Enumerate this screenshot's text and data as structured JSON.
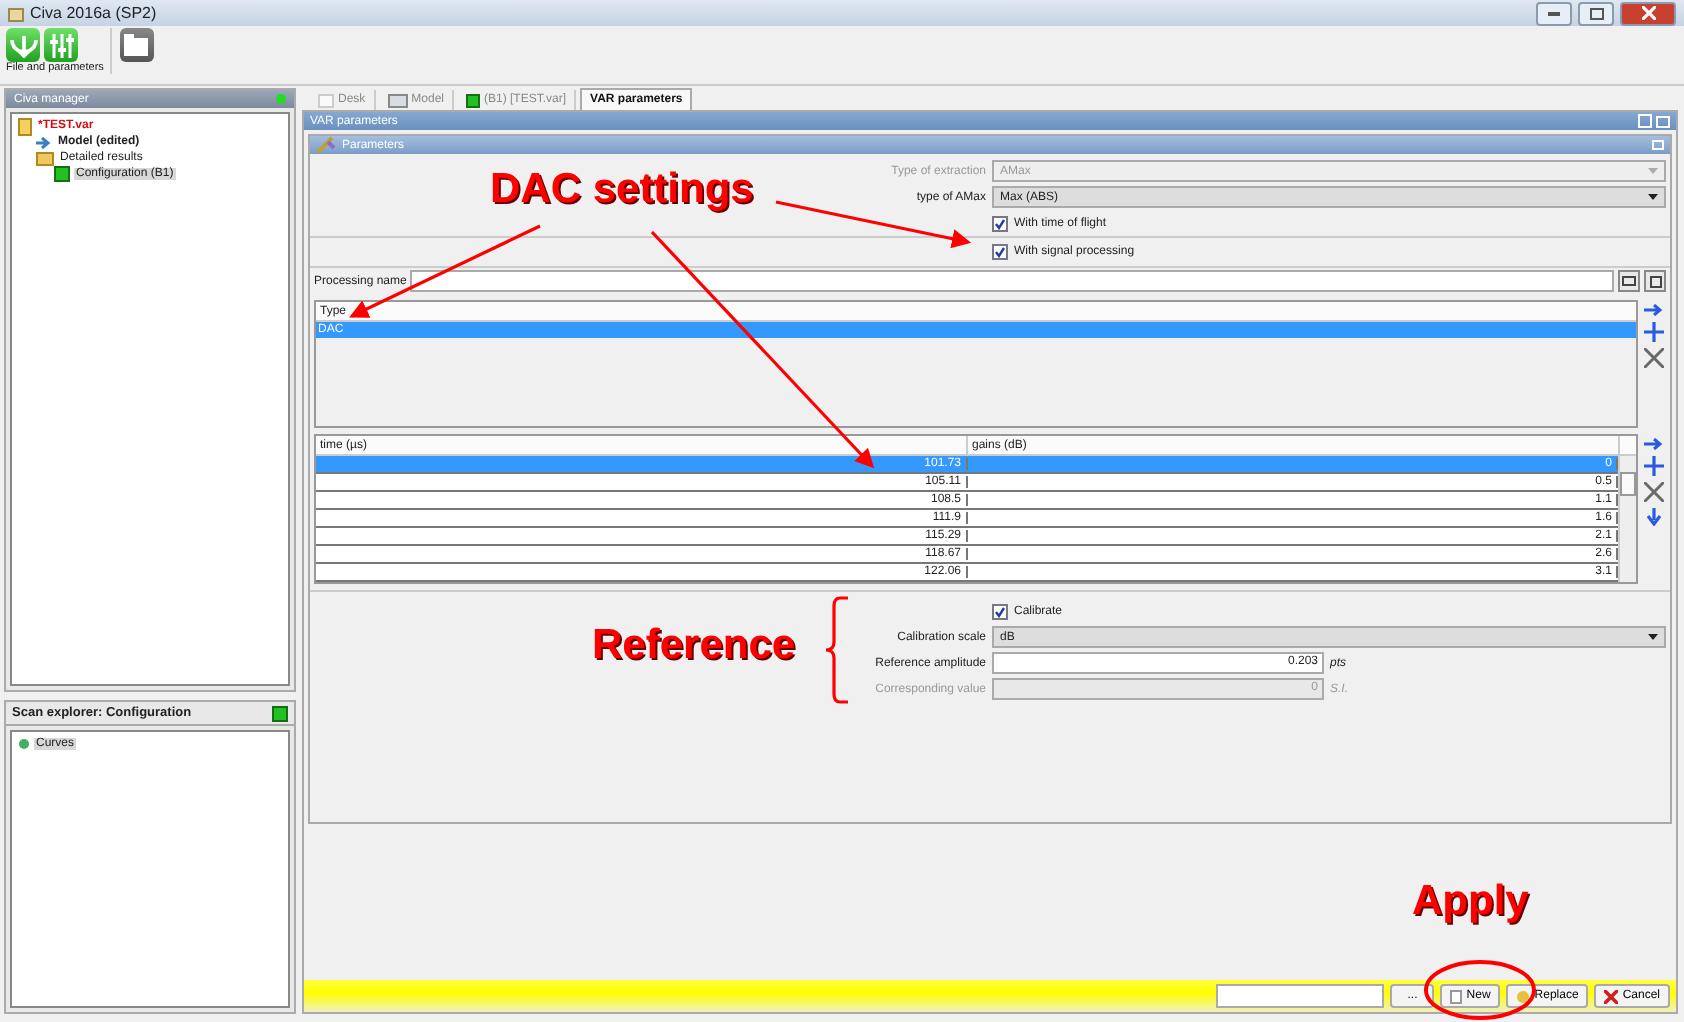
{
  "window": {
    "title": "Civa 2016a (SP2)"
  },
  "toolbar": {
    "group_label": "File and parameters"
  },
  "civa_manager": {
    "title": "Civa manager",
    "tree": [
      {
        "label": "*TEST.var",
        "kind": "file",
        "selected": false,
        "children": [
          {
            "label": "Model (edited)",
            "kind": "model",
            "selected": false
          },
          {
            "label": "Detailed results",
            "kind": "folder",
            "selected": false,
            "children": [
              {
                "label": "Configuration (B1)",
                "kind": "config",
                "selected": true
              }
            ]
          }
        ]
      }
    ]
  },
  "scan_explorer": {
    "title": "Scan explorer: Configuration",
    "tree": [
      {
        "label": "Curves",
        "kind": "curve",
        "selected": true
      }
    ]
  },
  "tabs": [
    {
      "label": "Desk",
      "kind": "blank",
      "selected": false
    },
    {
      "label": "Model",
      "kind": "model",
      "selected": false
    },
    {
      "label": "(B1) [TEST.var]",
      "kind": "config",
      "selected": false
    },
    {
      "label": "VAR parameters",
      "kind": "plain",
      "selected": true
    }
  ],
  "panel": {
    "title": "VAR parameters",
    "subtitle": "Parameters"
  },
  "form": {
    "selects": [
      {
        "label": "Type of extraction",
        "value": "AMax",
        "disabled": true
      },
      {
        "label": "type of AMax",
        "value": "Max (ABS)",
        "disabled": false
      }
    ],
    "checkboxes": [
      {
        "label": "With time of flight",
        "checked": true
      },
      {
        "label": "With signal processing",
        "checked": true
      }
    ],
    "processing_name": {
      "label": "Processing name"
    }
  },
  "type_table": {
    "columns": [
      "Type"
    ],
    "rows": [
      {
        "cells": [
          "DAC"
        ],
        "selected": true
      }
    ]
  },
  "dac_table": {
    "columns": [
      "time (µs)",
      "gains (dB)"
    ],
    "rows": [
      {
        "cells": [
          "101.73",
          "0"
        ],
        "selected": true
      },
      {
        "cells": [
          "105.11",
          "0.5"
        ],
        "selected": false
      },
      {
        "cells": [
          "108.5",
          "1.1"
        ],
        "selected": false
      },
      {
        "cells": [
          "111.9",
          "1.6"
        ],
        "selected": false
      },
      {
        "cells": [
          "115.29",
          "2.1"
        ],
        "selected": false
      },
      {
        "cells": [
          "118.67",
          "2.6"
        ],
        "selected": false
      },
      {
        "cells": [
          "122.06",
          "3.1"
        ],
        "selected": false
      }
    ]
  },
  "calibration": {
    "calibrate": {
      "label": "Calibrate",
      "checked": true
    },
    "scale": {
      "label": "Calibration scale",
      "value": "dB"
    },
    "fields": [
      {
        "label": "Reference amplitude",
        "value": "0.203",
        "unit": "pts",
        "disabled": false
      },
      {
        "label": "Corresponding value",
        "value": "0",
        "unit": "S.I.",
        "disabled": true
      }
    ]
  },
  "bottom_bar": {
    "browse": "...",
    "buttons": [
      {
        "label": "New",
        "kind": "new"
      },
      {
        "label": "Replace",
        "kind": "replace"
      },
      {
        "label": "Cancel",
        "kind": "cancel"
      }
    ]
  },
  "annotations": [
    {
      "text": "DAC settings"
    },
    {
      "text": "Reference"
    },
    {
      "text": "Apply"
    }
  ]
}
